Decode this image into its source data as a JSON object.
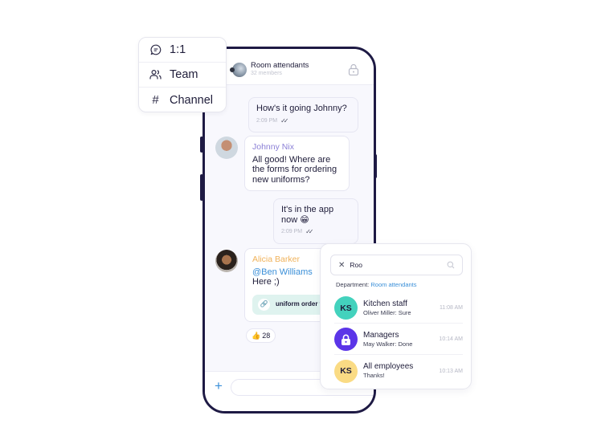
{
  "menu": {
    "items": [
      {
        "label": "1:1",
        "icon": "chat-bubble-icon"
      },
      {
        "label": "Team",
        "icon": "users-icon"
      },
      {
        "label": "Channel",
        "icon": "hash-icon"
      }
    ]
  },
  "chat": {
    "title": "Room attendants",
    "subtitle": "32 members",
    "messages": [
      {
        "direction": "out",
        "text": "How's it going Johnny?",
        "time": "2:09 PM"
      },
      {
        "direction": "in",
        "sender": "Johnny Nix",
        "text": "All good! Where are the forms for ordering new uniforms?"
      },
      {
        "direction": "out",
        "text": "It's in the app now 😁",
        "time": "2:09 PM"
      },
      {
        "direction": "in",
        "sender": "Alicia Barker",
        "mention": "@Ben Williams",
        "text": "Here ;)",
        "attachment": "uniform order form",
        "reaction": {
          "emoji": "👍",
          "count": "28"
        }
      }
    ],
    "colors": {
      "johnny": "#8a7fd6",
      "alicia": "#f0b25a",
      "mention": "#3a8fd8"
    }
  },
  "search": {
    "query": "Roo",
    "department_label": "Department:",
    "department_value": "Room attendants",
    "results": [
      {
        "initials": "KS",
        "title": "Kitchen staff",
        "subtitle": "Oliver Miller: Sure",
        "time": "11:08 AM",
        "color": "#43d2bd"
      },
      {
        "initials": "",
        "icon": "lock-icon",
        "title": "Managers",
        "subtitle": "May Walker: Done",
        "time": "10:14 AM",
        "color": "#5b35e8"
      },
      {
        "initials": "KS",
        "title": "All employees",
        "subtitle": "Thanks!",
        "time": "10:13 AM",
        "color": "#fadb84"
      }
    ]
  }
}
